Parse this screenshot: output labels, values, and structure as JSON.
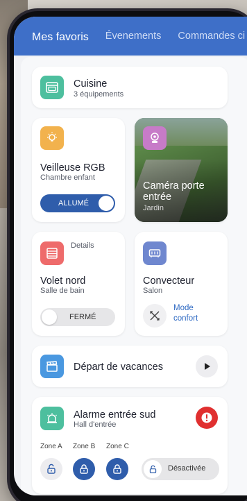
{
  "header": {
    "tabs": [
      {
        "label": "Mes favoris",
        "active": true
      },
      {
        "label": "Évenements",
        "active": false
      },
      {
        "label": "Commandes ci",
        "active": false
      }
    ]
  },
  "kitchen": {
    "title": "Cuisine",
    "subtitle": "3 équipements",
    "color": "#4dbf9e",
    "icon": "oven-icon"
  },
  "light": {
    "title": "Veilleuse RGB",
    "subtitle": "Chambre enfant",
    "toggle_label": "ALLUMÉ",
    "state": "on",
    "color": "#f2b24d",
    "icon": "bulb-icon"
  },
  "camera": {
    "title_line1": "Caméra porte",
    "title_line2": "entrée",
    "subtitle": "Jardin",
    "color": "#c77bc8",
    "icon": "camera-icon"
  },
  "shutter": {
    "details": "Details",
    "title": "Volet nord",
    "subtitle": "Salle de bain",
    "toggle_label": "FERMÉ",
    "state": "off",
    "color": "#ee6b6b",
    "icon": "shutter-icon"
  },
  "heater": {
    "title": "Convecteur",
    "subtitle": "Salon",
    "mode_line1": "Mode",
    "mode_line2": "confort",
    "color": "#6f87cf",
    "icon": "heater-icon"
  },
  "vacation": {
    "title": "Départ de vacances",
    "color": "#4a98e0",
    "icon": "clapper-icon"
  },
  "alarm": {
    "title": "Alarme entrée sud",
    "subtitle": "Hall d'entrée",
    "color": "#4dbf9e",
    "alert_color": "#e03030",
    "zones": [
      "Zone A",
      "Zone B",
      "Zone C"
    ],
    "status": "Désactivée",
    "icon": "alarm-light-icon"
  }
}
